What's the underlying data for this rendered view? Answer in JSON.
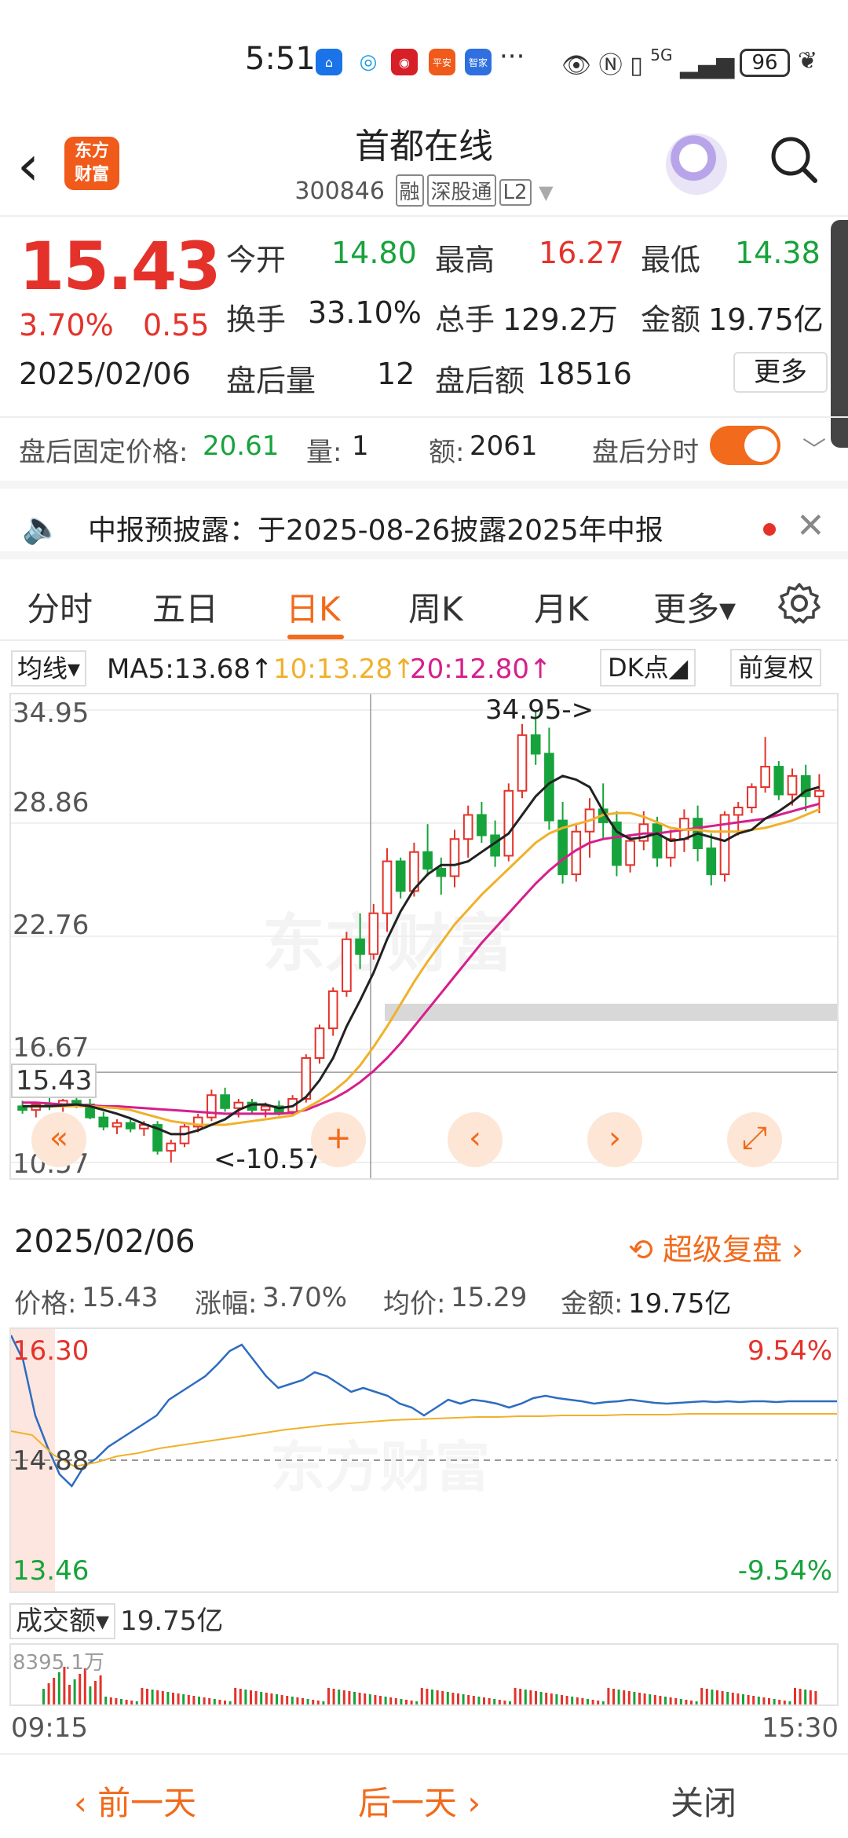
{
  "status_bar": {
    "time": "5:51",
    "network": "5G",
    "battery": "96"
  },
  "header": {
    "logo_text": "东方\n财富",
    "stock_name": "首都在线",
    "stock_code": "300846",
    "tags": [
      "融",
      "深股通",
      "L2"
    ]
  },
  "quote": {
    "price": "15.43",
    "change_pct": "3.70%",
    "change_amt": "0.55",
    "date": "2025/02/06",
    "open_label": "今开",
    "open": "14.80",
    "high_label": "最高",
    "high": "16.27",
    "low_label": "最低",
    "low": "14.38",
    "turnover_label": "换手",
    "turnover": "33.10%",
    "volume_label": "总手",
    "volume": "129.2万",
    "amount_label": "金额",
    "amount": "19.75亿",
    "after_vol_label": "盘后量",
    "after_vol": "12",
    "after_amt_label": "盘后额",
    "after_amt": "18516",
    "more_label": "更多"
  },
  "after_hours": {
    "fixed_price_label": "盘后固定价格:",
    "fixed_price": "20.61",
    "qty_label": "量:",
    "qty": "1",
    "amt_label": "额:",
    "amt": "2061",
    "toggle_label": "盘后分时"
  },
  "notice": {
    "text": "中报预披露：于2025-08-26披露2025年中报"
  },
  "tabs": [
    "分时",
    "五日",
    "日K",
    "周K",
    "月K",
    "更多▾"
  ],
  "active_tab": "日K",
  "ma_row": {
    "select": "均线▾",
    "ma5": "MA5:13.68↑",
    "ma10": "10:13.28↑",
    "ma20": "20:12.80↑",
    "dk": "DK点◢",
    "adjust": "前复权",
    "colors": {
      "ma5": "#222222",
      "ma10": "#f0b12b",
      "ma20": "#d61f8c"
    }
  },
  "kchart": {
    "y_labels": [
      "34.95",
      "28.86",
      "22.76",
      "16.67",
      "10.57"
    ],
    "current_price_label": "15.43",
    "max_annotation": "34.95->",
    "min_annotation": "<-10.57",
    "watermark": "东方财富"
  },
  "detail": {
    "date": "2025/02/06",
    "replay": "超级复盘 ›",
    "price_label": "价格:",
    "price": "15.43",
    "change_label": "涨幅:",
    "change": "3.70%",
    "avg_label": "均价:",
    "avg": "15.29",
    "amount_label": "金额:",
    "amount": "19.75亿",
    "y_top": "16.30",
    "y_mid": "14.88",
    "y_bot": "13.46",
    "pct_top": "9.54%",
    "pct_bot": "-9.54%",
    "vol_select": "成交额▾",
    "vol_total": "19.75亿",
    "vol_max": "8395.1万",
    "t_start": "09:15",
    "t_end": "15:30"
  },
  "bottom": {
    "prev": "‹ 前一天",
    "next": "后一天 ›",
    "close": "关闭"
  },
  "chart_data": {
    "type": "candlestick",
    "title": "",
    "ylim": [
      10.57,
      34.95
    ],
    "y_ticks": [
      34.95,
      28.86,
      22.76,
      16.67,
      10.57
    ],
    "last_close": 15.43,
    "candles": [
      [
        13.6,
        13.9,
        13.2,
        13.4
      ],
      [
        13.4,
        13.8,
        13.0,
        13.7
      ],
      [
        13.7,
        14.1,
        13.4,
        13.6
      ],
      [
        13.6,
        14.0,
        13.3,
        13.9
      ],
      [
        13.9,
        14.3,
        13.5,
        13.7
      ],
      [
        13.7,
        14.0,
        12.9,
        13.0
      ],
      [
        13.0,
        13.3,
        12.3,
        12.5
      ],
      [
        12.5,
        12.9,
        12.1,
        12.7
      ],
      [
        12.7,
        12.9,
        12.2,
        12.4
      ],
      [
        12.4,
        12.8,
        12.0,
        12.6
      ],
      [
        12.6,
        12.8,
        11.0,
        11.2
      ],
      [
        11.2,
        11.8,
        10.57,
        11.6
      ],
      [
        11.6,
        12.7,
        11.4,
        12.5
      ],
      [
        12.5,
        13.2,
        12.2,
        13.0
      ],
      [
        13.0,
        14.5,
        12.8,
        14.2
      ],
      [
        14.2,
        14.6,
        13.3,
        13.5
      ],
      [
        13.5,
        14.0,
        13.0,
        13.8
      ],
      [
        13.8,
        14.0,
        13.2,
        13.4
      ],
      [
        13.4,
        13.8,
        13.0,
        13.6
      ],
      [
        13.6,
        13.9,
        13.1,
        13.3
      ],
      [
        13.3,
        14.2,
        13.1,
        14.0
      ],
      [
        14.0,
        16.4,
        13.8,
        16.2
      ],
      [
        16.2,
        18.0,
        15.9,
        17.8
      ],
      [
        17.8,
        20.0,
        17.4,
        19.8
      ],
      [
        19.8,
        23.0,
        19.5,
        22.6
      ],
      [
        22.6,
        24.0,
        21.0,
        21.8
      ],
      [
        21.8,
        24.5,
        21.5,
        24.0
      ],
      [
        24.0,
        27.5,
        23.0,
        26.8
      ],
      [
        26.8,
        27.0,
        24.8,
        25.2
      ],
      [
        25.2,
        27.8,
        24.9,
        27.3
      ],
      [
        27.3,
        28.8,
        26.0,
        26.4
      ],
      [
        26.4,
        27.0,
        25.0,
        26.0
      ],
      [
        26.0,
        28.5,
        25.4,
        28.0
      ],
      [
        28.0,
        29.8,
        27.0,
        29.3
      ],
      [
        29.3,
        30.0,
        27.8,
        28.2
      ],
      [
        28.2,
        29.0,
        26.5,
        27.1
      ],
      [
        27.1,
        31.0,
        26.8,
        30.6
      ],
      [
        30.6,
        34.2,
        30.2,
        33.6
      ],
      [
        33.6,
        34.95,
        32.0,
        32.6
      ],
      [
        32.6,
        34.0,
        28.5,
        29.0
      ],
      [
        29.0,
        30.0,
        25.6,
        26.1
      ],
      [
        26.1,
        28.8,
        25.7,
        28.4
      ],
      [
        28.4,
        30.2,
        27.0,
        29.6
      ],
      [
        29.6,
        31.0,
        28.0,
        28.9
      ],
      [
        28.9,
        29.5,
        26.0,
        26.6
      ],
      [
        26.6,
        28.2,
        26.2,
        27.9
      ],
      [
        27.9,
        29.5,
        27.4,
        28.8
      ],
      [
        28.8,
        29.2,
        26.5,
        27.0
      ],
      [
        27.0,
        28.5,
        26.5,
        28.0
      ],
      [
        28.0,
        29.6,
        27.3,
        29.1
      ],
      [
        29.1,
        29.8,
        26.8,
        27.5
      ],
      [
        27.5,
        28.3,
        25.5,
        26.1
      ],
      [
        26.1,
        29.5,
        25.7,
        29.3
      ],
      [
        29.3,
        30.0,
        28.2,
        29.7
      ],
      [
        29.7,
        31.0,
        29.4,
        30.8
      ],
      [
        30.8,
        33.5,
        30.5,
        31.9
      ],
      [
        31.9,
        32.2,
        30.1,
        30.4
      ],
      [
        30.4,
        31.8,
        29.8,
        31.4
      ],
      [
        31.4,
        32.0,
        29.5,
        30.3
      ],
      [
        30.3,
        31.5,
        29.4,
        30.6
      ]
    ],
    "ma5": [
      13.6,
      13.6,
      13.6,
      13.65,
      13.7,
      13.6,
      13.4,
      13.2,
      12.95,
      12.65,
      12.4,
      12.1,
      12.1,
      12.3,
      12.6,
      12.9,
      13.4,
      13.7,
      13.7,
      13.5,
      13.6,
      14.1,
      15.0,
      16.2,
      17.9,
      19.3,
      20.8,
      22.6,
      24.1,
      25.3,
      26.1,
      26.6,
      26.6,
      26.8,
      27.3,
      27.8,
      28.3,
      29.3,
      30.3,
      31.0,
      31.4,
      31.2,
      30.8,
      29.5,
      28.4,
      28.0,
      28.1,
      28.3,
      27.9,
      28.0,
      28.3,
      28.1,
      27.9,
      28.3,
      28.5,
      29.1,
      29.5,
      30.0,
      30.6,
      30.8
    ],
    "ma10": [
      13.6,
      13.6,
      13.6,
      13.6,
      13.6,
      13.6,
      13.55,
      13.5,
      13.4,
      13.2,
      13.0,
      12.8,
      12.7,
      12.6,
      12.6,
      12.6,
      12.7,
      12.8,
      12.9,
      13.0,
      13.1,
      13.5,
      13.9,
      14.4,
      15.0,
      15.8,
      16.8,
      17.9,
      19.1,
      20.3,
      21.4,
      22.4,
      23.4,
      24.2,
      25.0,
      25.7,
      26.4,
      27.1,
      27.8,
      28.3,
      28.6,
      28.8,
      29.0,
      29.3,
      29.4,
      29.4,
      29.2,
      28.9,
      28.6,
      28.5,
      28.5,
      28.4,
      28.4,
      28.4,
      28.5,
      28.6,
      28.8,
      29.0,
      29.3,
      29.6
    ],
    "ma20": [
      13.8,
      13.8,
      13.75,
      13.7,
      13.7,
      13.65,
      13.6,
      13.6,
      13.55,
      13.5,
      13.45,
      13.4,
      13.35,
      13.3,
      13.25,
      13.2,
      13.2,
      13.2,
      13.2,
      13.2,
      13.25,
      13.4,
      13.7,
      14.0,
      14.4,
      14.9,
      15.5,
      16.2,
      17.0,
      17.9,
      18.8,
      19.7,
      20.6,
      21.5,
      22.4,
      23.2,
      24.0,
      24.8,
      25.6,
      26.3,
      26.9,
      27.4,
      27.8,
      28.0,
      28.1,
      28.2,
      28.3,
      28.3,
      28.4,
      28.5,
      28.6,
      28.7,
      28.8,
      28.9,
      29.0,
      29.1,
      29.3,
      29.5,
      29.7,
      29.9
    ]
  }
}
